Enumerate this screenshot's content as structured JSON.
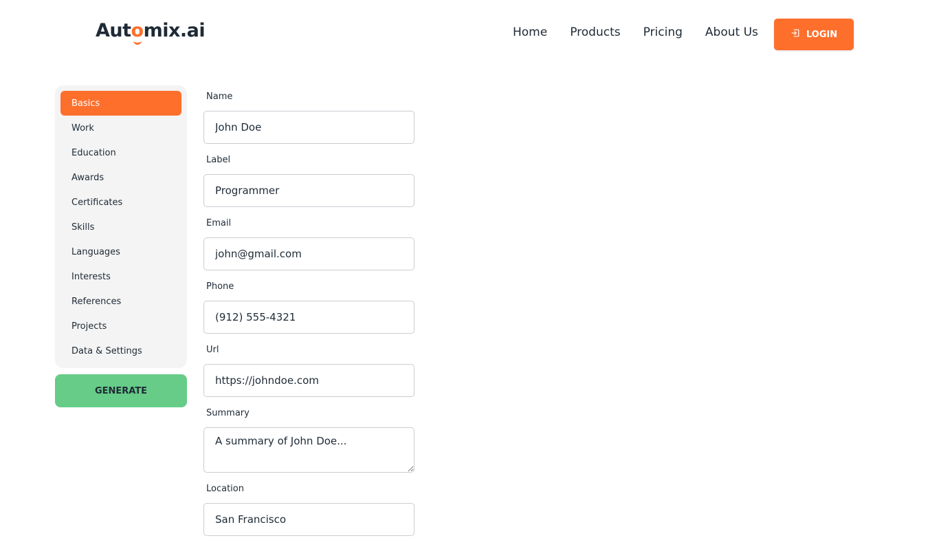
{
  "brand": {
    "logo_prefix": "Aut",
    "logo_o": "o",
    "logo_suffix": "mix.ai"
  },
  "nav": {
    "items": [
      "Home",
      "Products",
      "Pricing",
      "About Us"
    ],
    "login_label": "LOGIN"
  },
  "sidebar": {
    "items": [
      {
        "label": "Basics",
        "active": true
      },
      {
        "label": "Work"
      },
      {
        "label": "Education"
      },
      {
        "label": "Awards"
      },
      {
        "label": "Certificates"
      },
      {
        "label": "Skills"
      },
      {
        "label": "Languages"
      },
      {
        "label": "Interests"
      },
      {
        "label": "References"
      },
      {
        "label": "Projects"
      },
      {
        "label": "Data & Settings"
      }
    ],
    "generate_label": "GENERATE"
  },
  "form": {
    "name": {
      "label": "Name",
      "value": "John Doe"
    },
    "label": {
      "label": "Label",
      "value": "Programmer"
    },
    "email": {
      "label": "Email",
      "value": "john@gmail.com"
    },
    "phone": {
      "label": "Phone",
      "value": "(912) 555-4321"
    },
    "url": {
      "label": "Url",
      "value": "https://johndoe.com"
    },
    "summary": {
      "label": "Summary",
      "value": "A summary of John Doe..."
    },
    "location": {
      "label": "Location",
      "value": "San Francisco"
    }
  },
  "colors": {
    "accent": "#ff6f2c",
    "generate": "#66cc88",
    "sidebar_bg": "#f4f4f4",
    "text": "#1e2a36"
  }
}
